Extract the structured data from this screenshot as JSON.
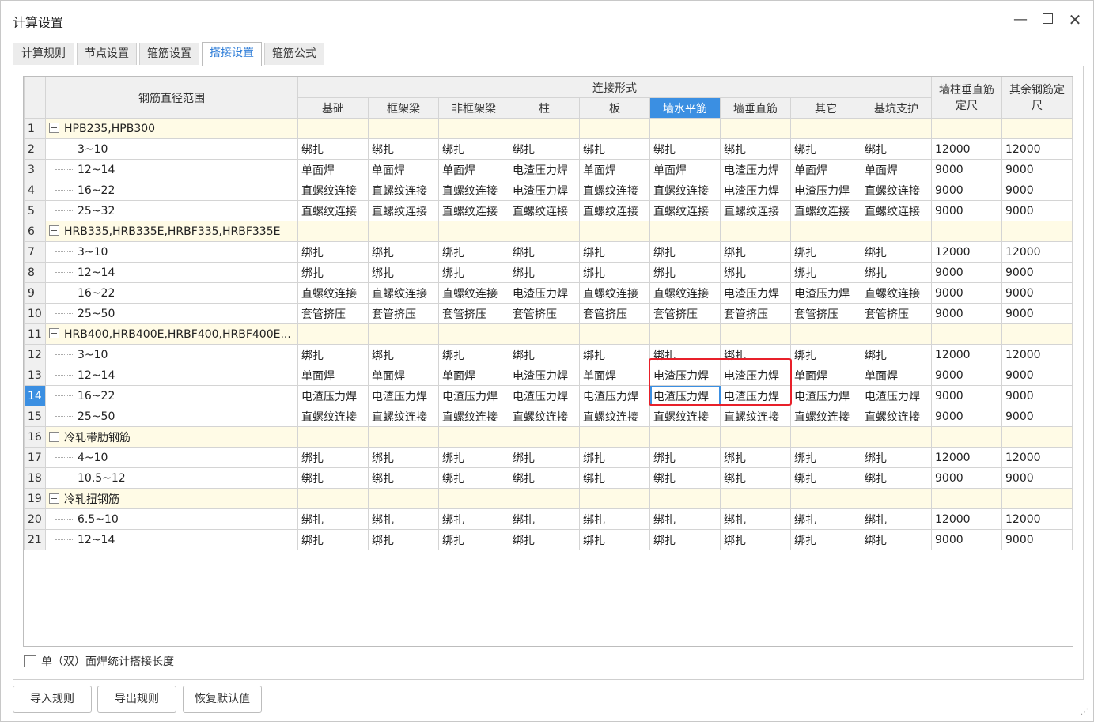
{
  "window": {
    "title": "计算设置"
  },
  "tabs": [
    "计算规则",
    "节点设置",
    "箍筋设置",
    "搭接设置",
    "箍筋公式"
  ],
  "active_tab": 3,
  "table": {
    "corner_label": "钢筋直径范围",
    "group_header": "连接形式",
    "columns": [
      "基础",
      "框架梁",
      "非框架梁",
      "柱",
      "板",
      "墙水平筋",
      "墙垂直筋",
      "其它",
      "基坑支护"
    ],
    "extra_columns": [
      "墙柱垂直筋定尺",
      "其余钢筋定尺"
    ],
    "selected_column": 5,
    "rows": [
      {
        "num": "1",
        "label": "HPB235,HPB300",
        "group": true
      },
      {
        "num": "2",
        "label": "3~10",
        "cells": [
          "绑扎",
          "绑扎",
          "绑扎",
          "绑扎",
          "绑扎",
          "绑扎",
          "绑扎",
          "绑扎",
          "绑扎"
        ],
        "len1": "12000",
        "len2": "12000"
      },
      {
        "num": "3",
        "label": "12~14",
        "cells": [
          "单面焊",
          "单面焊",
          "单面焊",
          "电渣压力焊",
          "单面焊",
          "单面焊",
          "电渣压力焊",
          "单面焊",
          "单面焊"
        ],
        "len1": "9000",
        "len2": "9000"
      },
      {
        "num": "4",
        "label": "16~22",
        "cells": [
          "直螺纹连接",
          "直螺纹连接",
          "直螺纹连接",
          "电渣压力焊",
          "直螺纹连接",
          "直螺纹连接",
          "电渣压力焊",
          "电渣压力焊",
          "直螺纹连接"
        ],
        "len1": "9000",
        "len2": "9000"
      },
      {
        "num": "5",
        "label": "25~32",
        "cells": [
          "直螺纹连接",
          "直螺纹连接",
          "直螺纹连接",
          "直螺纹连接",
          "直螺纹连接",
          "直螺纹连接",
          "直螺纹连接",
          "直螺纹连接",
          "直螺纹连接"
        ],
        "len1": "9000",
        "len2": "9000"
      },
      {
        "num": "6",
        "label": "HRB335,HRB335E,HRBF335,HRBF335E",
        "group": true
      },
      {
        "num": "7",
        "label": "3~10",
        "cells": [
          "绑扎",
          "绑扎",
          "绑扎",
          "绑扎",
          "绑扎",
          "绑扎",
          "绑扎",
          "绑扎",
          "绑扎"
        ],
        "len1": "12000",
        "len2": "12000"
      },
      {
        "num": "8",
        "label": "12~14",
        "cells": [
          "绑扎",
          "绑扎",
          "绑扎",
          "绑扎",
          "绑扎",
          "绑扎",
          "绑扎",
          "绑扎",
          "绑扎"
        ],
        "len1": "9000",
        "len2": "9000"
      },
      {
        "num": "9",
        "label": "16~22",
        "cells": [
          "直螺纹连接",
          "直螺纹连接",
          "直螺纹连接",
          "电渣压力焊",
          "直螺纹连接",
          "直螺纹连接",
          "电渣压力焊",
          "电渣压力焊",
          "直螺纹连接"
        ],
        "len1": "9000",
        "len2": "9000"
      },
      {
        "num": "10",
        "label": "25~50",
        "cells": [
          "套管挤压",
          "套管挤压",
          "套管挤压",
          "套管挤压",
          "套管挤压",
          "套管挤压",
          "套管挤压",
          "套管挤压",
          "套管挤压"
        ],
        "len1": "9000",
        "len2": "9000"
      },
      {
        "num": "11",
        "label": "HRB400,HRB400E,HRBF400,HRBF400E...",
        "group": true
      },
      {
        "num": "12",
        "label": "3~10",
        "cells": [
          "绑扎",
          "绑扎",
          "绑扎",
          "绑扎",
          "绑扎",
          "绑扎",
          "绑扎",
          "绑扎",
          "绑扎"
        ],
        "len1": "12000",
        "len2": "12000"
      },
      {
        "num": "13",
        "label": "12~14",
        "cells": [
          "单面焊",
          "单面焊",
          "单面焊",
          "电渣压力焊",
          "单面焊",
          "电渣压力焊",
          "电渣压力焊",
          "单面焊",
          "单面焊"
        ],
        "len1": "9000",
        "len2": "9000"
      },
      {
        "num": "14",
        "label": "16~22",
        "cells": [
          "电渣压力焊",
          "电渣压力焊",
          "电渣压力焊",
          "电渣压力焊",
          "电渣压力焊",
          "电渣压力焊",
          "电渣压力焊",
          "电渣压力焊",
          "电渣压力焊"
        ],
        "len1": "9000",
        "len2": "9000",
        "selected": true
      },
      {
        "num": "15",
        "label": "25~50",
        "cells": [
          "直螺纹连接",
          "直螺纹连接",
          "直螺纹连接",
          "直螺纹连接",
          "直螺纹连接",
          "直螺纹连接",
          "直螺纹连接",
          "直螺纹连接",
          "直螺纹连接"
        ],
        "len1": "9000",
        "len2": "9000"
      },
      {
        "num": "16",
        "label": "冷轧带肋钢筋",
        "group": true
      },
      {
        "num": "17",
        "label": "4~10",
        "cells": [
          "绑扎",
          "绑扎",
          "绑扎",
          "绑扎",
          "绑扎",
          "绑扎",
          "绑扎",
          "绑扎",
          "绑扎"
        ],
        "len1": "12000",
        "len2": "12000"
      },
      {
        "num": "18",
        "label": "10.5~12",
        "cells": [
          "绑扎",
          "绑扎",
          "绑扎",
          "绑扎",
          "绑扎",
          "绑扎",
          "绑扎",
          "绑扎",
          "绑扎"
        ],
        "len1": "9000",
        "len2": "9000"
      },
      {
        "num": "19",
        "label": "冷轧扭钢筋",
        "group": true
      },
      {
        "num": "20",
        "label": "6.5~10",
        "cells": [
          "绑扎",
          "绑扎",
          "绑扎",
          "绑扎",
          "绑扎",
          "绑扎",
          "绑扎",
          "绑扎",
          "绑扎"
        ],
        "len1": "12000",
        "len2": "12000"
      },
      {
        "num": "21",
        "label": "12~14",
        "cells": [
          "绑扎",
          "绑扎",
          "绑扎",
          "绑扎",
          "绑扎",
          "绑扎",
          "绑扎",
          "绑扎",
          "绑扎"
        ],
        "len1": "9000",
        "len2": "9000"
      }
    ]
  },
  "checkbox": {
    "label": "单（双）面焊统计搭接长度",
    "checked": false
  },
  "buttons": {
    "import": "导入规则",
    "export": "导出规则",
    "restore": "恢复默认值"
  },
  "colors": {
    "header_blue": "#5aaaf0",
    "selected_blue": "#3b8fe2",
    "group_row": "#fffbe6",
    "highlight_red": "#e8202a"
  }
}
